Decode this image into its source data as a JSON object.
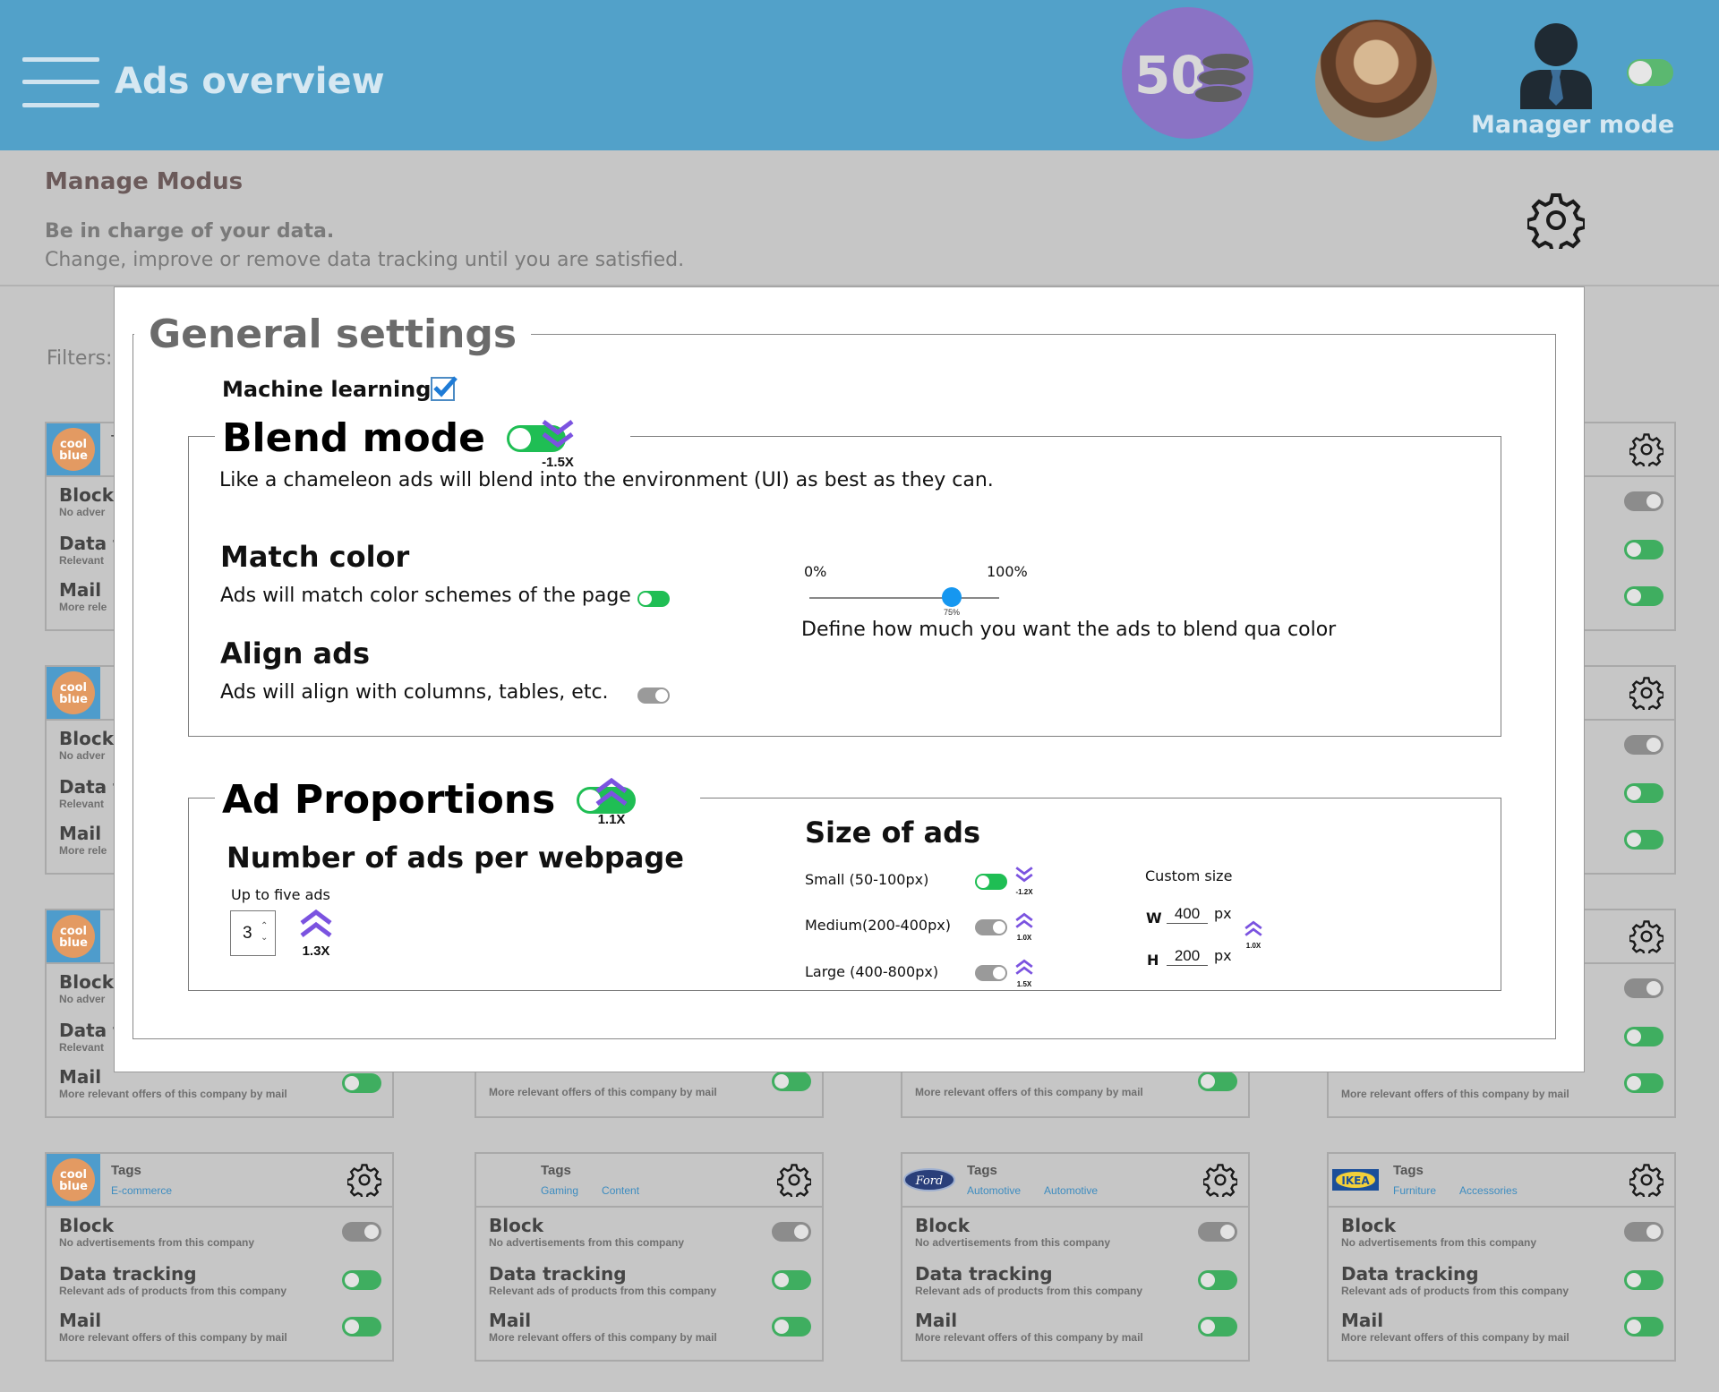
{
  "header": {
    "title": "Ads overview",
    "points": "50",
    "manager_label": "Manager mode",
    "manager_mode_on": true
  },
  "manage": {
    "title": "Manage Modus",
    "subtitle_bold": "Be in charge of your data.",
    "subtitle": "Change, improve or remove data tracking until you are satisfied."
  },
  "filters_label": "Filters:",
  "card_text": {
    "tags_title": "Tags",
    "block_title": "Block",
    "block_desc": "No advertisements from this company",
    "tracking_title": "Data tracking",
    "tracking_desc": "Relevant ads of products from this company",
    "mail_title": "Mail",
    "mail_desc": "More relevant offers of this company by mail",
    "partial_tracking": "Data tr",
    "partial_block_desc": "No adver",
    "partial_tracking_desc": "Relevant",
    "partial_mail_desc": "More rele",
    "partial_right_any": "any",
    "partial_right_mail": "mail",
    "partial_t": "T"
  },
  "bottom_cards": [
    {
      "logo": "coolblue",
      "logo_text": "cool blue",
      "tags": [
        "E-commerce"
      ]
    },
    {
      "logo": "none",
      "logo_text": "",
      "tags": [
        "Gaming",
        "Content"
      ]
    },
    {
      "logo": "ford",
      "logo_text": "Ford",
      "tags": [
        "Automotive",
        "Automotive"
      ]
    },
    {
      "logo": "ikea",
      "logo_text": "IKEA",
      "tags": [
        "Furniture",
        "Accessories"
      ]
    }
  ],
  "modal": {
    "title": "General settings",
    "machine_learning_label": "Machine learning",
    "machine_learning_checked": true,
    "blend": {
      "title": "Blend mode",
      "multiplier": "-1.5X",
      "description": "Like a chameleon ads will blend into the environment (UI) as best as they can.",
      "match_color_title": "Match color",
      "match_color_desc": "Ads will match color schemes of the page",
      "align_title": "Align ads",
      "align_desc": "Ads will align with columns, tables, etc.",
      "slider_min": "0%",
      "slider_max": "100%",
      "slider_value": "75%",
      "slider_fraction": 0.75,
      "slider_desc": "Define how much you want the ads to blend qua color"
    },
    "proportions": {
      "title": "Ad Proportions",
      "multiplier": "1.1X",
      "count_title": "Number of ads per webpage",
      "count_hint": "Up to five ads",
      "count_value": "3",
      "count_multiplier": "1.3X",
      "size_title": "Size of ads",
      "small_label": "Small (50-100px)",
      "small_mult": "-1.2X",
      "medium_label": "Medium(200-400px)",
      "medium_mult": "1.0X",
      "large_label": "Large (400-800px)",
      "large_mult": "1.5X",
      "custom_label": "Custom size",
      "w_label": "W",
      "w_value": "400",
      "h_label": "H",
      "h_value": "200",
      "unit": "px",
      "custom_mult": "1.0X"
    }
  },
  "colors": {
    "header_bg": "#52a1c9",
    "toggle_on": "#1fbe54",
    "multiplier_purple": "#7b53e0",
    "slider_blue": "#1697f0"
  }
}
